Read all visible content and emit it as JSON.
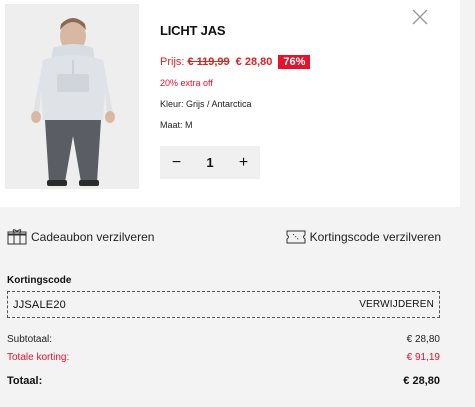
{
  "product": {
    "title": "LICHT JAS",
    "price_label": "Prijs:",
    "price_old": "€ 119,99",
    "price_new": "€ 28,80",
    "discount_badge": "76%",
    "extra_off": "20% extra off",
    "color": "Kleur: Grijs / Antarctica",
    "size": "Maat: M",
    "quantity": "1",
    "qty_minus": "−",
    "qty_plus": "+",
    "image_icon": "jacket-model-photo"
  },
  "actions": {
    "gift_label": "Cadeaubon verzilveren",
    "coupon_label": "Kortingscode verzilveren"
  },
  "code": {
    "label": "Kortingscode",
    "value": "JJSALE20",
    "remove_label": "VERWIJDEREN"
  },
  "summary": {
    "subtotal_label": "Subtotaal:",
    "subtotal_value": "€ 28,80",
    "discount_label": "Totale korting:",
    "discount_value": "€ 91,19",
    "total_label": "Totaal:",
    "total_value": "€ 28,80"
  },
  "colors": {
    "accent_red": "#e8112d",
    "background": "#f3f3f3",
    "card": "#ffffff"
  }
}
